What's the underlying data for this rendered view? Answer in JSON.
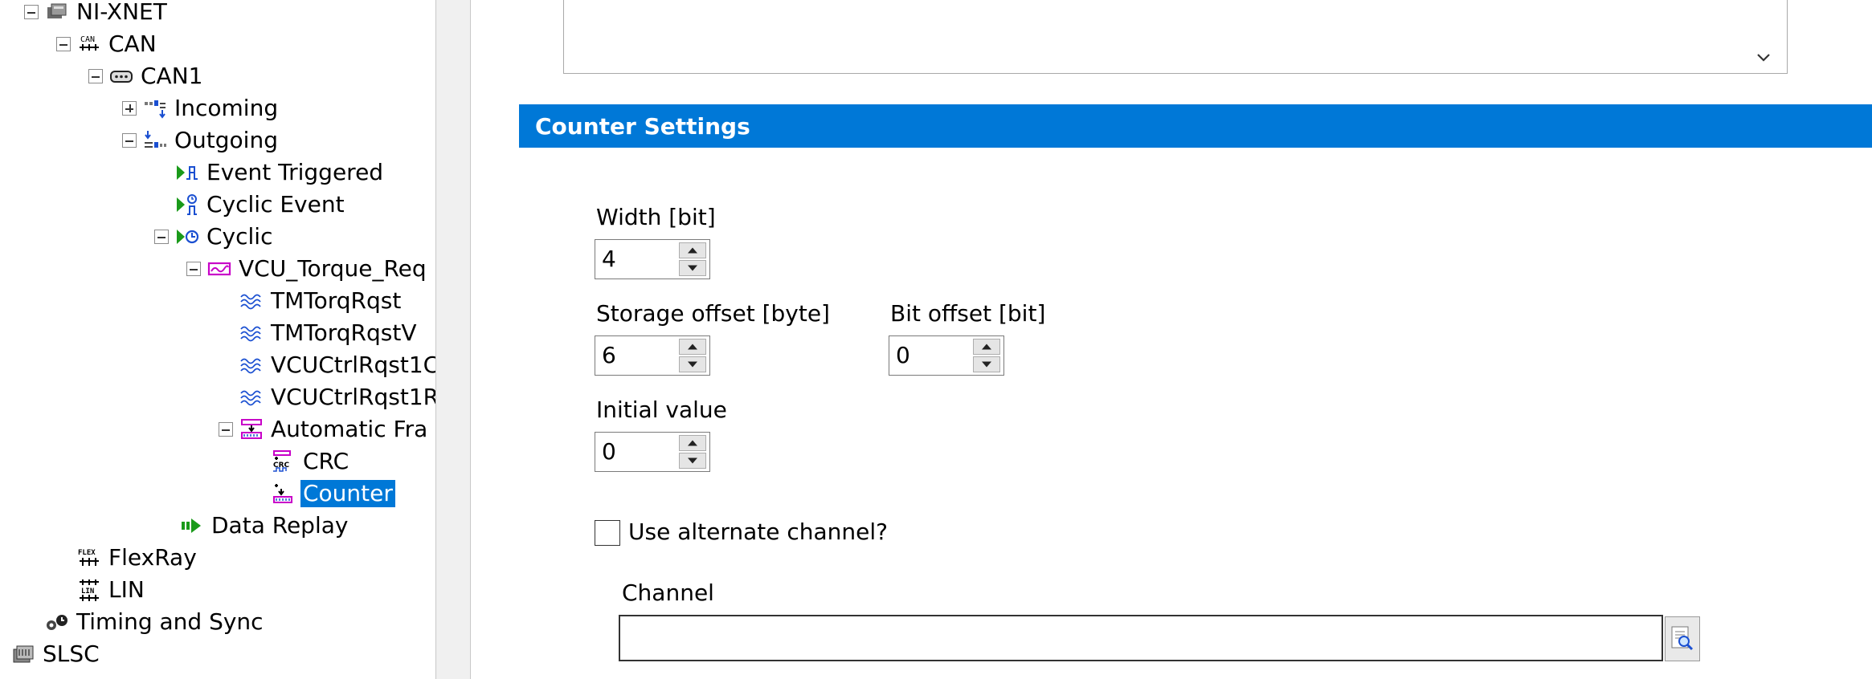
{
  "tree": {
    "items": [
      {
        "label": "NI-XNET",
        "icon": "network-device-icon"
      },
      {
        "label": "CAN",
        "icon": "can-bus-icon"
      },
      {
        "label": "CAN1",
        "icon": "can-port-icon"
      },
      {
        "label": "Incoming",
        "icon": "incoming-frames-icon"
      },
      {
        "label": "Outgoing",
        "icon": "outgoing-frames-icon"
      },
      {
        "label": "Event Triggered",
        "icon": "event-triggered-icon"
      },
      {
        "label": "Cyclic Event",
        "icon": "cyclic-event-icon"
      },
      {
        "label": "Cyclic",
        "icon": "cyclic-icon"
      },
      {
        "label": "VCU_Torque_Req",
        "icon": "frame-icon"
      },
      {
        "label": "TMTorqRqst",
        "icon": "signal-icon"
      },
      {
        "label": "TMTorqRqstV",
        "icon": "signal-icon"
      },
      {
        "label": "VCUCtrlRqst1C",
        "icon": "signal-icon"
      },
      {
        "label": "VCUCtrlRqst1R",
        "icon": "signal-icon"
      },
      {
        "label": "Automatic Fra",
        "icon": "automatic-frame-icon"
      },
      {
        "label": "CRC",
        "icon": "crc-icon"
      },
      {
        "label": "Counter",
        "icon": "counter-icon"
      },
      {
        "label": "Data Replay",
        "icon": "data-replay-icon"
      },
      {
        "label": "FlexRay",
        "icon": "flexray-icon"
      },
      {
        "label": "LIN",
        "icon": "lin-icon"
      },
      {
        "label": "Timing and Sync",
        "icon": "timing-sync-icon"
      },
      {
        "label": "SLSC",
        "icon": "slsc-icon"
      }
    ]
  },
  "counter_settings": {
    "title": "Counter Settings",
    "width_label": "Width [bit]",
    "width_value": "4",
    "storage_offset_label": "Storage offset [byte]",
    "storage_offset_value": "6",
    "bit_offset_label": "Bit offset [bit]",
    "bit_offset_value": "0",
    "initial_value_label": "Initial value",
    "initial_value": "0",
    "alternate_channel_label": "Use alternate channel?",
    "alternate_channel_checked": false,
    "channel_label": "Channel",
    "channel_value": ""
  },
  "colors": {
    "accent": "#0078d7",
    "icon_pink": "#c800c8",
    "icon_green": "#1a9a1a",
    "icon_blue": "#1a4fd1"
  }
}
